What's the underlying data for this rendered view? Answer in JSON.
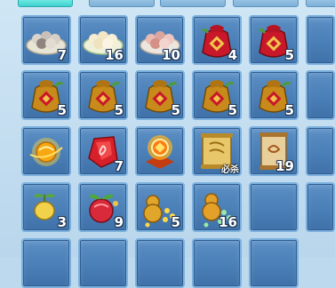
{
  "inventory": {
    "slots": [
      {
        "item": "tangyuan-plate-white-icon",
        "count": "7"
      },
      {
        "item": "tangyuan-plate-cream-icon",
        "count": "16"
      },
      {
        "item": "tangyuan-plate-pink-icon",
        "count": "10"
      },
      {
        "item": "red-lucky-bag-icon",
        "count": "4"
      },
      {
        "item": "red-lucky-bag-icon",
        "count": "5"
      },
      {
        "item": "gold-lucky-bag-icon",
        "count": "5"
      },
      {
        "item": "gold-lucky-bag-icon",
        "count": "5"
      },
      {
        "item": "gold-lucky-bag-icon",
        "count": "5"
      },
      {
        "item": "gold-lucky-bag-icon",
        "count": "5"
      },
      {
        "item": "gold-lucky-bag-icon",
        "count": "5"
      },
      {
        "item": "golden-orb-icon",
        "count": ""
      },
      {
        "item": "red-gem-icon",
        "count": "7"
      },
      {
        "item": "glowing-token-icon",
        "count": ""
      },
      {
        "item": "golden-scroll-icon",
        "count": "",
        "badge": "必杀"
      },
      {
        "item": "parchment-scroll-icon",
        "count": "19"
      },
      {
        "item": "golden-fruit-icon",
        "count": "3"
      },
      {
        "item": "red-fruit-icon",
        "count": "9"
      },
      {
        "item": "gourd-coins-icon",
        "count": "5"
      },
      {
        "item": "gourd-green-beads-icon",
        "count": "16"
      },
      {
        "item": "empty-slot",
        "count": ""
      }
    ]
  }
}
